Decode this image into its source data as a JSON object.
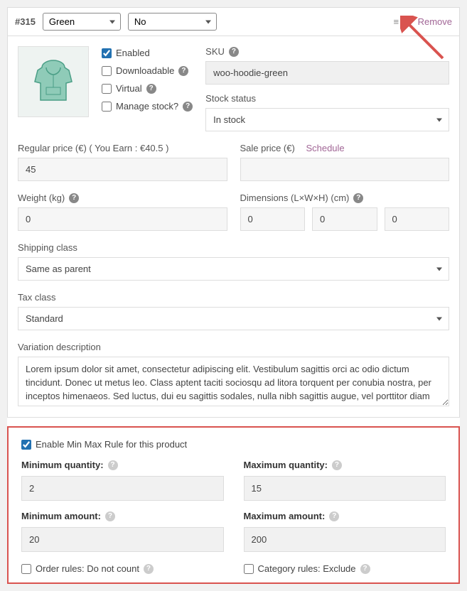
{
  "header": {
    "id": "#315",
    "color": "Green",
    "logo": "No",
    "remove": "Remove"
  },
  "thumb": {
    "alt": "Green hoodie thumbnail"
  },
  "checks": {
    "enabled": "Enabled",
    "downloadable": "Downloadable",
    "virtual": "Virtual",
    "manage_stock": "Manage stock?"
  },
  "sku": {
    "label": "SKU",
    "value": "woo-hoodie-green"
  },
  "stock": {
    "label": "Stock status",
    "value": "In stock"
  },
  "regular_price": {
    "label": "Regular price (€) ( You Earn : €40.5 )",
    "value": "45"
  },
  "sale_price": {
    "label": "Sale price (€)",
    "schedule": "Schedule",
    "value": ""
  },
  "weight": {
    "label": "Weight (kg)",
    "value": "0"
  },
  "dimensions": {
    "label": "Dimensions (L×W×H) (cm)",
    "l": "0",
    "w": "0",
    "h": "0"
  },
  "shipping": {
    "label": "Shipping class",
    "value": "Same as parent"
  },
  "tax": {
    "label": "Tax class",
    "value": "Standard"
  },
  "description": {
    "label": "Variation description",
    "value": "Lorem ipsum dolor sit amet, consectetur adipiscing elit. Vestibulum sagittis orci ac odio dictum tincidunt. Donec ut metus leo. Class aptent taciti sociosqu ad litora torquent per conubia nostra, per inceptos himenaeos. Sed luctus, dui eu sagittis sodales, nulla nibh sagittis augue, vel porttitor diam enim non metus. Vestibulum aliquam augue neque. Phasellus tincidunt odio eget ullamcorper efficitur. Cras placerat ut"
  },
  "rules": {
    "enable": "Enable Min Max Rule for this product",
    "min_qty": {
      "label": "Minimum quantity:",
      "value": "2"
    },
    "max_qty": {
      "label": "Maximum quantity:",
      "value": "15"
    },
    "min_amt": {
      "label": "Minimum amount:",
      "value": "20"
    },
    "max_amt": {
      "label": "Maximum amount:",
      "value": "200"
    },
    "order_rule": "Order rules: Do not count",
    "category_rule": "Category rules: Exclude"
  }
}
